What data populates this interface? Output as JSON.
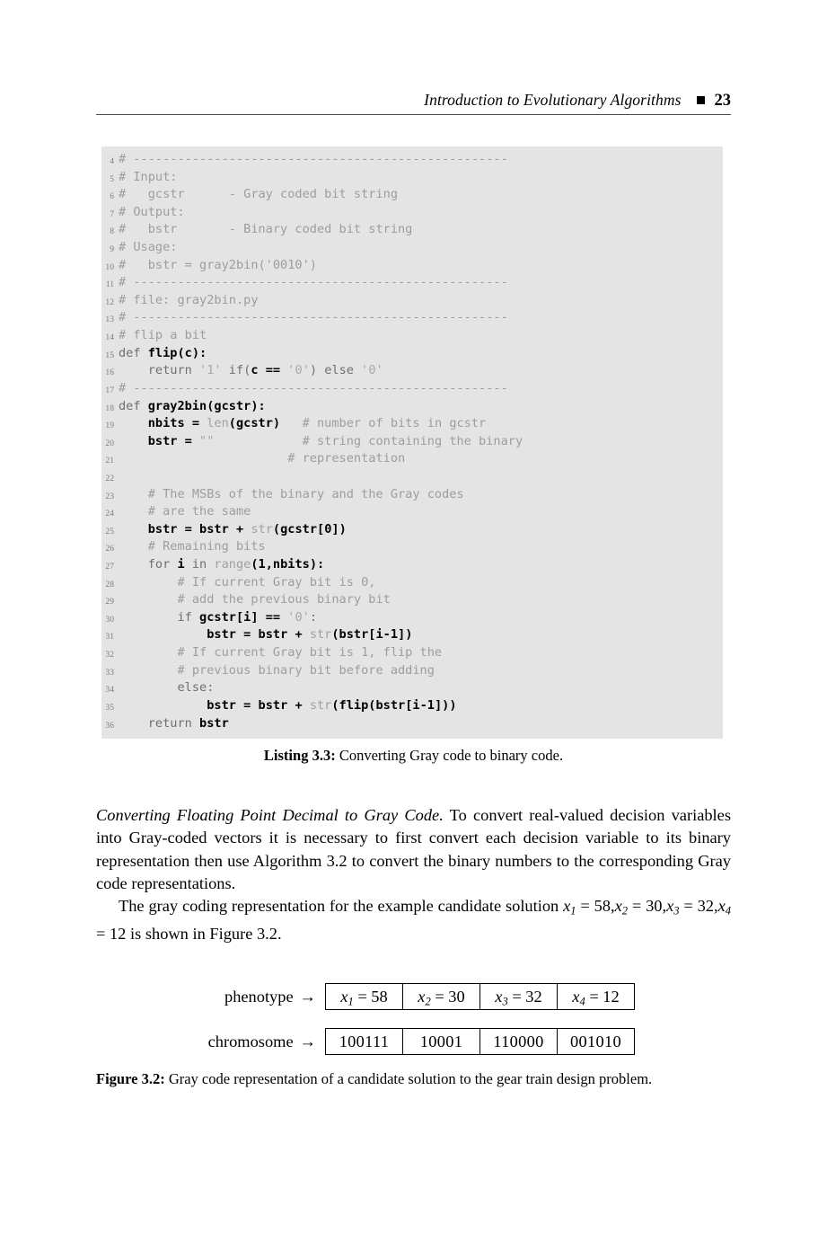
{
  "running_head": {
    "title": "Introduction to Evolutionary Algorithms",
    "marker": "square-bullet",
    "page_number": "23"
  },
  "listing": {
    "caption_label": "Listing 3.3:",
    "caption_text": " Converting Gray code to binary code.",
    "background": "#e4e4e4",
    "first_line_number": 4,
    "lines": [
      {
        "n": "4",
        "tokens": [
          {
            "t": "cmt",
            "s": "# ---------------------------------------------------"
          }
        ]
      },
      {
        "n": "5",
        "tokens": [
          {
            "t": "cmt",
            "s": "# Input:"
          }
        ]
      },
      {
        "n": "6",
        "tokens": [
          {
            "t": "cmt",
            "s": "#   gcstr      - Gray coded bit string"
          }
        ]
      },
      {
        "n": "7",
        "tokens": [
          {
            "t": "cmt",
            "s": "# Output:"
          }
        ]
      },
      {
        "n": "8",
        "tokens": [
          {
            "t": "cmt",
            "s": "#   bstr       - Binary coded bit string"
          }
        ]
      },
      {
        "n": "9",
        "tokens": [
          {
            "t": "cmt",
            "s": "# Usage:"
          }
        ]
      },
      {
        "n": "10",
        "tokens": [
          {
            "t": "cmt",
            "s": "#   bstr = gray2bin('0010')"
          }
        ]
      },
      {
        "n": "11",
        "tokens": [
          {
            "t": "cmt",
            "s": "# ---------------------------------------------------"
          }
        ]
      },
      {
        "n": "12",
        "tokens": [
          {
            "t": "cmt",
            "s": "# file: gray2bin.py"
          }
        ]
      },
      {
        "n": "13",
        "tokens": [
          {
            "t": "cmt",
            "s": "# ---------------------------------------------------"
          }
        ]
      },
      {
        "n": "14",
        "tokens": [
          {
            "t": "cmt",
            "s": "# flip a bit"
          }
        ]
      },
      {
        "n": "15",
        "tokens": [
          {
            "t": "kw",
            "s": "def "
          },
          {
            "t": "id",
            "s": "flip(c):"
          }
        ]
      },
      {
        "n": "16",
        "tokens": [
          {
            "t": "kw",
            "s": "    return "
          },
          {
            "t": "str",
            "s": "'1' "
          },
          {
            "t": "kw",
            "s": "if("
          },
          {
            "t": "id",
            "s": "c "
          },
          {
            "t": "op",
            "s": "== "
          },
          {
            "t": "str",
            "s": "'0'"
          },
          {
            "t": "kw",
            "s": ") else "
          },
          {
            "t": "str",
            "s": "'0'"
          }
        ]
      },
      {
        "n": "17",
        "tokens": [
          {
            "t": "cmt",
            "s": "# ---------------------------------------------------"
          }
        ]
      },
      {
        "n": "18",
        "tokens": [
          {
            "t": "kw",
            "s": "def "
          },
          {
            "t": "id",
            "s": "gray2bin(gcstr):"
          }
        ]
      },
      {
        "n": "19",
        "tokens": [
          {
            "t": "id",
            "s": "    nbits "
          },
          {
            "t": "op",
            "s": "= "
          },
          {
            "t": "fn",
            "s": "len"
          },
          {
            "t": "id",
            "s": "(gcstr)"
          },
          {
            "t": "cmt",
            "s": "   # number of bits in gcstr"
          }
        ]
      },
      {
        "n": "20",
        "tokens": [
          {
            "t": "id",
            "s": "    bstr "
          },
          {
            "t": "op",
            "s": "= "
          },
          {
            "t": "str",
            "s": "\"\""
          },
          {
            "t": "cmt",
            "s": "            # string containing the binary"
          }
        ]
      },
      {
        "n": "21",
        "tokens": [
          {
            "t": "cmt",
            "s": "                       # representation"
          }
        ]
      },
      {
        "n": "22",
        "tokens": [
          {
            "t": "cmt",
            "s": ""
          }
        ]
      },
      {
        "n": "23",
        "tokens": [
          {
            "t": "cmt",
            "s": "    # The MSBs of the binary and the Gray codes"
          }
        ]
      },
      {
        "n": "24",
        "tokens": [
          {
            "t": "cmt",
            "s": "    # are the same"
          }
        ]
      },
      {
        "n": "25",
        "tokens": [
          {
            "t": "id",
            "s": "    bstr "
          },
          {
            "t": "op",
            "s": "= "
          },
          {
            "t": "id",
            "s": "bstr "
          },
          {
            "t": "op",
            "s": "+ "
          },
          {
            "t": "fn",
            "s": "str"
          },
          {
            "t": "id",
            "s": "(gcstr[0])"
          }
        ]
      },
      {
        "n": "26",
        "tokens": [
          {
            "t": "cmt",
            "s": "    # Remaining bits"
          }
        ]
      },
      {
        "n": "27",
        "tokens": [
          {
            "t": "kw",
            "s": "    for "
          },
          {
            "t": "id",
            "s": "i "
          },
          {
            "t": "kw",
            "s": "in "
          },
          {
            "t": "fn",
            "s": "range"
          },
          {
            "t": "id",
            "s": "(1,nbits):"
          }
        ]
      },
      {
        "n": "28",
        "tokens": [
          {
            "t": "cmt",
            "s": "        # If current Gray bit is 0,"
          }
        ]
      },
      {
        "n": "29",
        "tokens": [
          {
            "t": "cmt",
            "s": "        # add the previous binary bit"
          }
        ]
      },
      {
        "n": "30",
        "tokens": [
          {
            "t": "kw",
            "s": "        if "
          },
          {
            "t": "id",
            "s": "gcstr[i] "
          },
          {
            "t": "op",
            "s": "== "
          },
          {
            "t": "str",
            "s": "'0'"
          },
          {
            "t": "kw",
            "s": ":"
          }
        ]
      },
      {
        "n": "31",
        "tokens": [
          {
            "t": "id",
            "s": "            bstr "
          },
          {
            "t": "op",
            "s": "= "
          },
          {
            "t": "id",
            "s": "bstr "
          },
          {
            "t": "op",
            "s": "+ "
          },
          {
            "t": "fn",
            "s": "str"
          },
          {
            "t": "id",
            "s": "(bstr[i-1])"
          }
        ]
      },
      {
        "n": "32",
        "tokens": [
          {
            "t": "cmt",
            "s": "        # If current Gray bit is 1, flip the"
          }
        ]
      },
      {
        "n": "33",
        "tokens": [
          {
            "t": "cmt",
            "s": "        # previous binary bit before adding"
          }
        ]
      },
      {
        "n": "34",
        "tokens": [
          {
            "t": "kw",
            "s": "        else:"
          }
        ]
      },
      {
        "n": "35",
        "tokens": [
          {
            "t": "id",
            "s": "            bstr "
          },
          {
            "t": "op",
            "s": "= "
          },
          {
            "t": "id",
            "s": "bstr "
          },
          {
            "t": "op",
            "s": "+ "
          },
          {
            "t": "fn",
            "s": "str"
          },
          {
            "t": "id",
            "s": "(flip(bstr[i-1]))"
          }
        ]
      },
      {
        "n": "36",
        "tokens": [
          {
            "t": "kw",
            "s": "    return "
          },
          {
            "t": "id",
            "s": "bstr"
          }
        ]
      }
    ]
  },
  "paragraph": {
    "run_in_heading": "Converting Floating Point Decimal to Gray Code.",
    "text_1": " To convert real-valued decision variables into Gray-coded vectors it is necessary to first convert each decision variable to its binary representation then use Algorithm 3.2 to convert the binary numbers to the corresponding Gray code representations.",
    "text_2_a": "The gray coding representation for the example candidate solution ",
    "text_2_b": " is shown in Figure 3.2."
  },
  "figure": {
    "caption_label": "Figure 3.2:",
    "caption_text": " Gray code representation of a candidate solution to the gear train design problem.",
    "rows": [
      {
        "label": "phenotype",
        "arrow": "→",
        "cells": [
          {
            "var": "x",
            "sub": "1",
            "eq": " = ",
            "value": "58"
          },
          {
            "var": "x",
            "sub": "2",
            "eq": " = ",
            "value": "30"
          },
          {
            "var": "x",
            "sub": "3",
            "eq": " = ",
            "value": "32"
          },
          {
            "var": "x",
            "sub": "4",
            "eq": " = ",
            "value": "12"
          }
        ]
      },
      {
        "label": "chromosome",
        "arrow": "→",
        "cells": [
          {
            "value": "100111"
          },
          {
            "value": "10001"
          },
          {
            "value": "110000"
          },
          {
            "value": "001010"
          }
        ]
      }
    ]
  }
}
